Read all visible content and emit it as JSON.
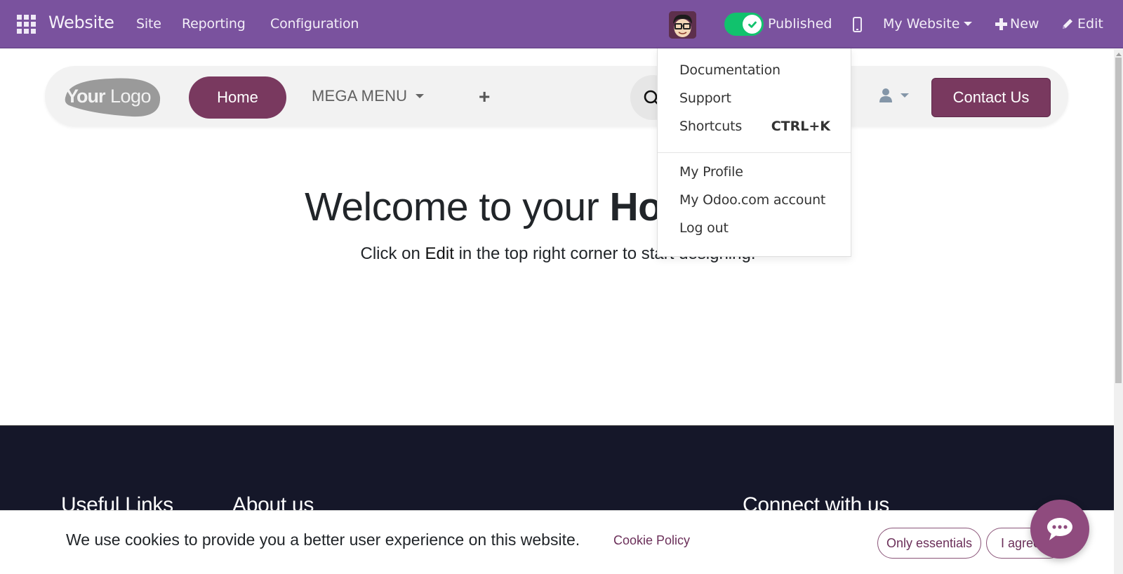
{
  "topbar": {
    "app_name": "Website",
    "menus": [
      "Site",
      "Reporting",
      "Configuration"
    ],
    "published_label": "Published",
    "published_state": true,
    "website_selector": "My Website",
    "new_label": "New",
    "edit_label": "Edit"
  },
  "site_header": {
    "logo_text": "YourLogo",
    "nav": {
      "home": "Home",
      "mega_menu": "MEGA MENU",
      "add": "+"
    },
    "contact_label": "Contact Us"
  },
  "hero": {
    "title_prefix": "Welcome to your ",
    "title_bold": "Homepage",
    "subtitle_prefix": "Click on ",
    "subtitle_em": "Edit",
    "subtitle_suffix": " in the top right corner to start designing."
  },
  "user_dropdown": {
    "items": [
      {
        "label": "Documentation"
      },
      {
        "label": "Support"
      },
      {
        "label": "Shortcuts",
        "shortcut": "CTRL+K"
      },
      {
        "label": "My Profile"
      },
      {
        "label": "My Odoo.com account"
      },
      {
        "label": "Log out"
      }
    ]
  },
  "footer": {
    "headings": [
      "Useful Links",
      "About us",
      "Connect with us"
    ]
  },
  "cookie_bar": {
    "message": "We use cookies to provide you a better user experience on this website.",
    "policy_link": "Cookie Policy",
    "only_essentials": "Only essentials",
    "agree": "I agree"
  },
  "colors": {
    "admin_bar": "#7a529e",
    "brand": "#79395f",
    "published_toggle": "#11c26d",
    "footer_bg": "#151729",
    "chat_button": "#8f4b7e"
  }
}
